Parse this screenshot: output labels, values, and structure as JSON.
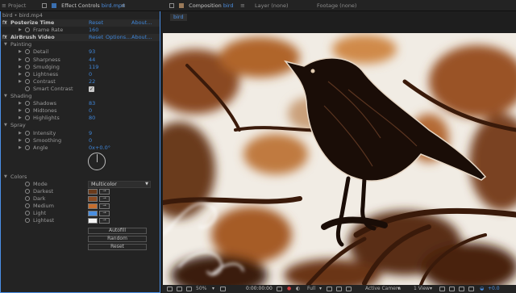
{
  "header": {
    "project_tab": "Project",
    "effect_controls_prefix": "Effect Controls",
    "effect_controls_file": "bird.mp4",
    "composition_prefix": "Composition",
    "composition_name": "bird",
    "layer_tab": "Layer (none)",
    "footage_tab": "Footage (none)"
  },
  "effects_panel": {
    "breadcrumb": "bird • bird.mp4",
    "rows": [
      {
        "kind": "effect",
        "label": "Posterize Time",
        "reset": "Reset",
        "about": "About..."
      },
      {
        "kind": "param",
        "label": "Frame Rate",
        "value": "160"
      },
      {
        "kind": "effect",
        "label": "AirBrush Video",
        "reset": "Reset",
        "options": "Options...",
        "about": "About..."
      },
      {
        "kind": "group",
        "label": "Painting"
      },
      {
        "kind": "param",
        "label": "Detail",
        "value": "93"
      },
      {
        "kind": "param",
        "label": "Sharpness",
        "value": "44"
      },
      {
        "kind": "param",
        "label": "Smudging",
        "value": "119"
      },
      {
        "kind": "param",
        "label": "Lightness",
        "value": "0"
      },
      {
        "kind": "param",
        "label": "Contrast",
        "value": "22"
      },
      {
        "kind": "check",
        "label": "Smart Contrast",
        "checked": true
      },
      {
        "kind": "group",
        "label": "Shading"
      },
      {
        "kind": "param",
        "label": "Shadows",
        "value": "83"
      },
      {
        "kind": "param",
        "label": "Midtones",
        "value": "0"
      },
      {
        "kind": "param",
        "label": "Highlights",
        "value": "80"
      },
      {
        "kind": "group",
        "label": "Spray"
      },
      {
        "kind": "param",
        "label": "Intensity",
        "value": "9"
      },
      {
        "kind": "param",
        "label": "Smoothing",
        "value": "0"
      },
      {
        "kind": "param",
        "label": "Angle",
        "value": "0x+0.0°"
      },
      {
        "kind": "group",
        "label": "Colors"
      },
      {
        "kind": "select",
        "label": "Mode",
        "value": "Multicolor"
      },
      {
        "kind": "color",
        "label": "Darkest",
        "color": "#6a3b1c"
      },
      {
        "kind": "color",
        "label": "Dark",
        "color": "#8a4a22"
      },
      {
        "kind": "color",
        "label": "Medium",
        "color": "#c66e2e"
      },
      {
        "kind": "color",
        "label": "Light",
        "color": "#4a8fe0"
      },
      {
        "kind": "color",
        "label": "Lightest",
        "color": "#f4f4f4"
      }
    ],
    "buttons": [
      "Autofill",
      "Random",
      "Reset"
    ]
  },
  "composition": {
    "tab_label": "bird",
    "zoom": "50%",
    "timecode": "0:00:00:00",
    "resolution": "Full",
    "camera": "Active Camera",
    "views": "1 View",
    "offset": "+0.0"
  },
  "colors": {
    "accent": "#4a8fe6",
    "link": "#3f86d8",
    "panel_bg": "#232323"
  }
}
